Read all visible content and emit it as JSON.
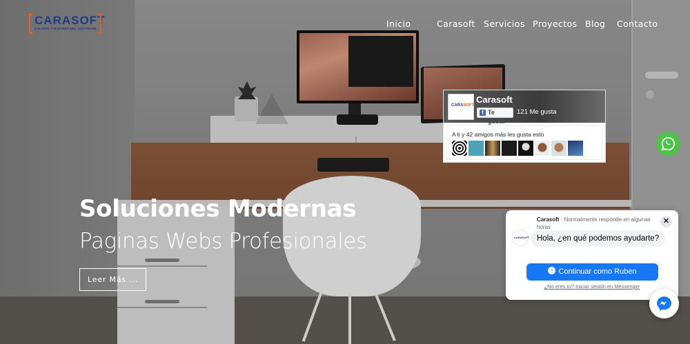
{
  "brand": {
    "name": "CARASOFT",
    "tagline": "CALIDAD Y RAPIDEZ DEL SOFTWARE",
    "primary_color": "#1f3c88",
    "accent_color": "#e85d28"
  },
  "nav": {
    "items": [
      {
        "label": "Inicio"
      },
      {
        "label": "Carasoft"
      },
      {
        "label": "Servicios"
      },
      {
        "label": "Proyectos"
      },
      {
        "label": "Blog"
      },
      {
        "label": "Contacto"
      }
    ]
  },
  "hero": {
    "title": "Soluciones Modernas",
    "subtitle": "Paginas Webs Profesionales",
    "button_label": "Leer Más ..."
  },
  "facebook_widget": {
    "page_name": "Carasoft",
    "like_label": "Te gusta",
    "like_count": "121 Me gusta",
    "friends_text": "A ti y 42 amigos más les gusta esto",
    "friend_faces": 8
  },
  "whatsapp": {
    "icon": "whatsapp-icon",
    "color": "#4dc247"
  },
  "messenger_chat": {
    "page_name": "Carasoft",
    "status": " · Normalmente responde en algunas horas",
    "greeting": "Hola, ¿en qué podemos ayudarte?",
    "continue_label": "Continuar como Ruben",
    "switch_link": "¿No eres tú? Iniciar sesión en Messenger",
    "close_icon": "close-icon",
    "color": "#1877f2"
  }
}
